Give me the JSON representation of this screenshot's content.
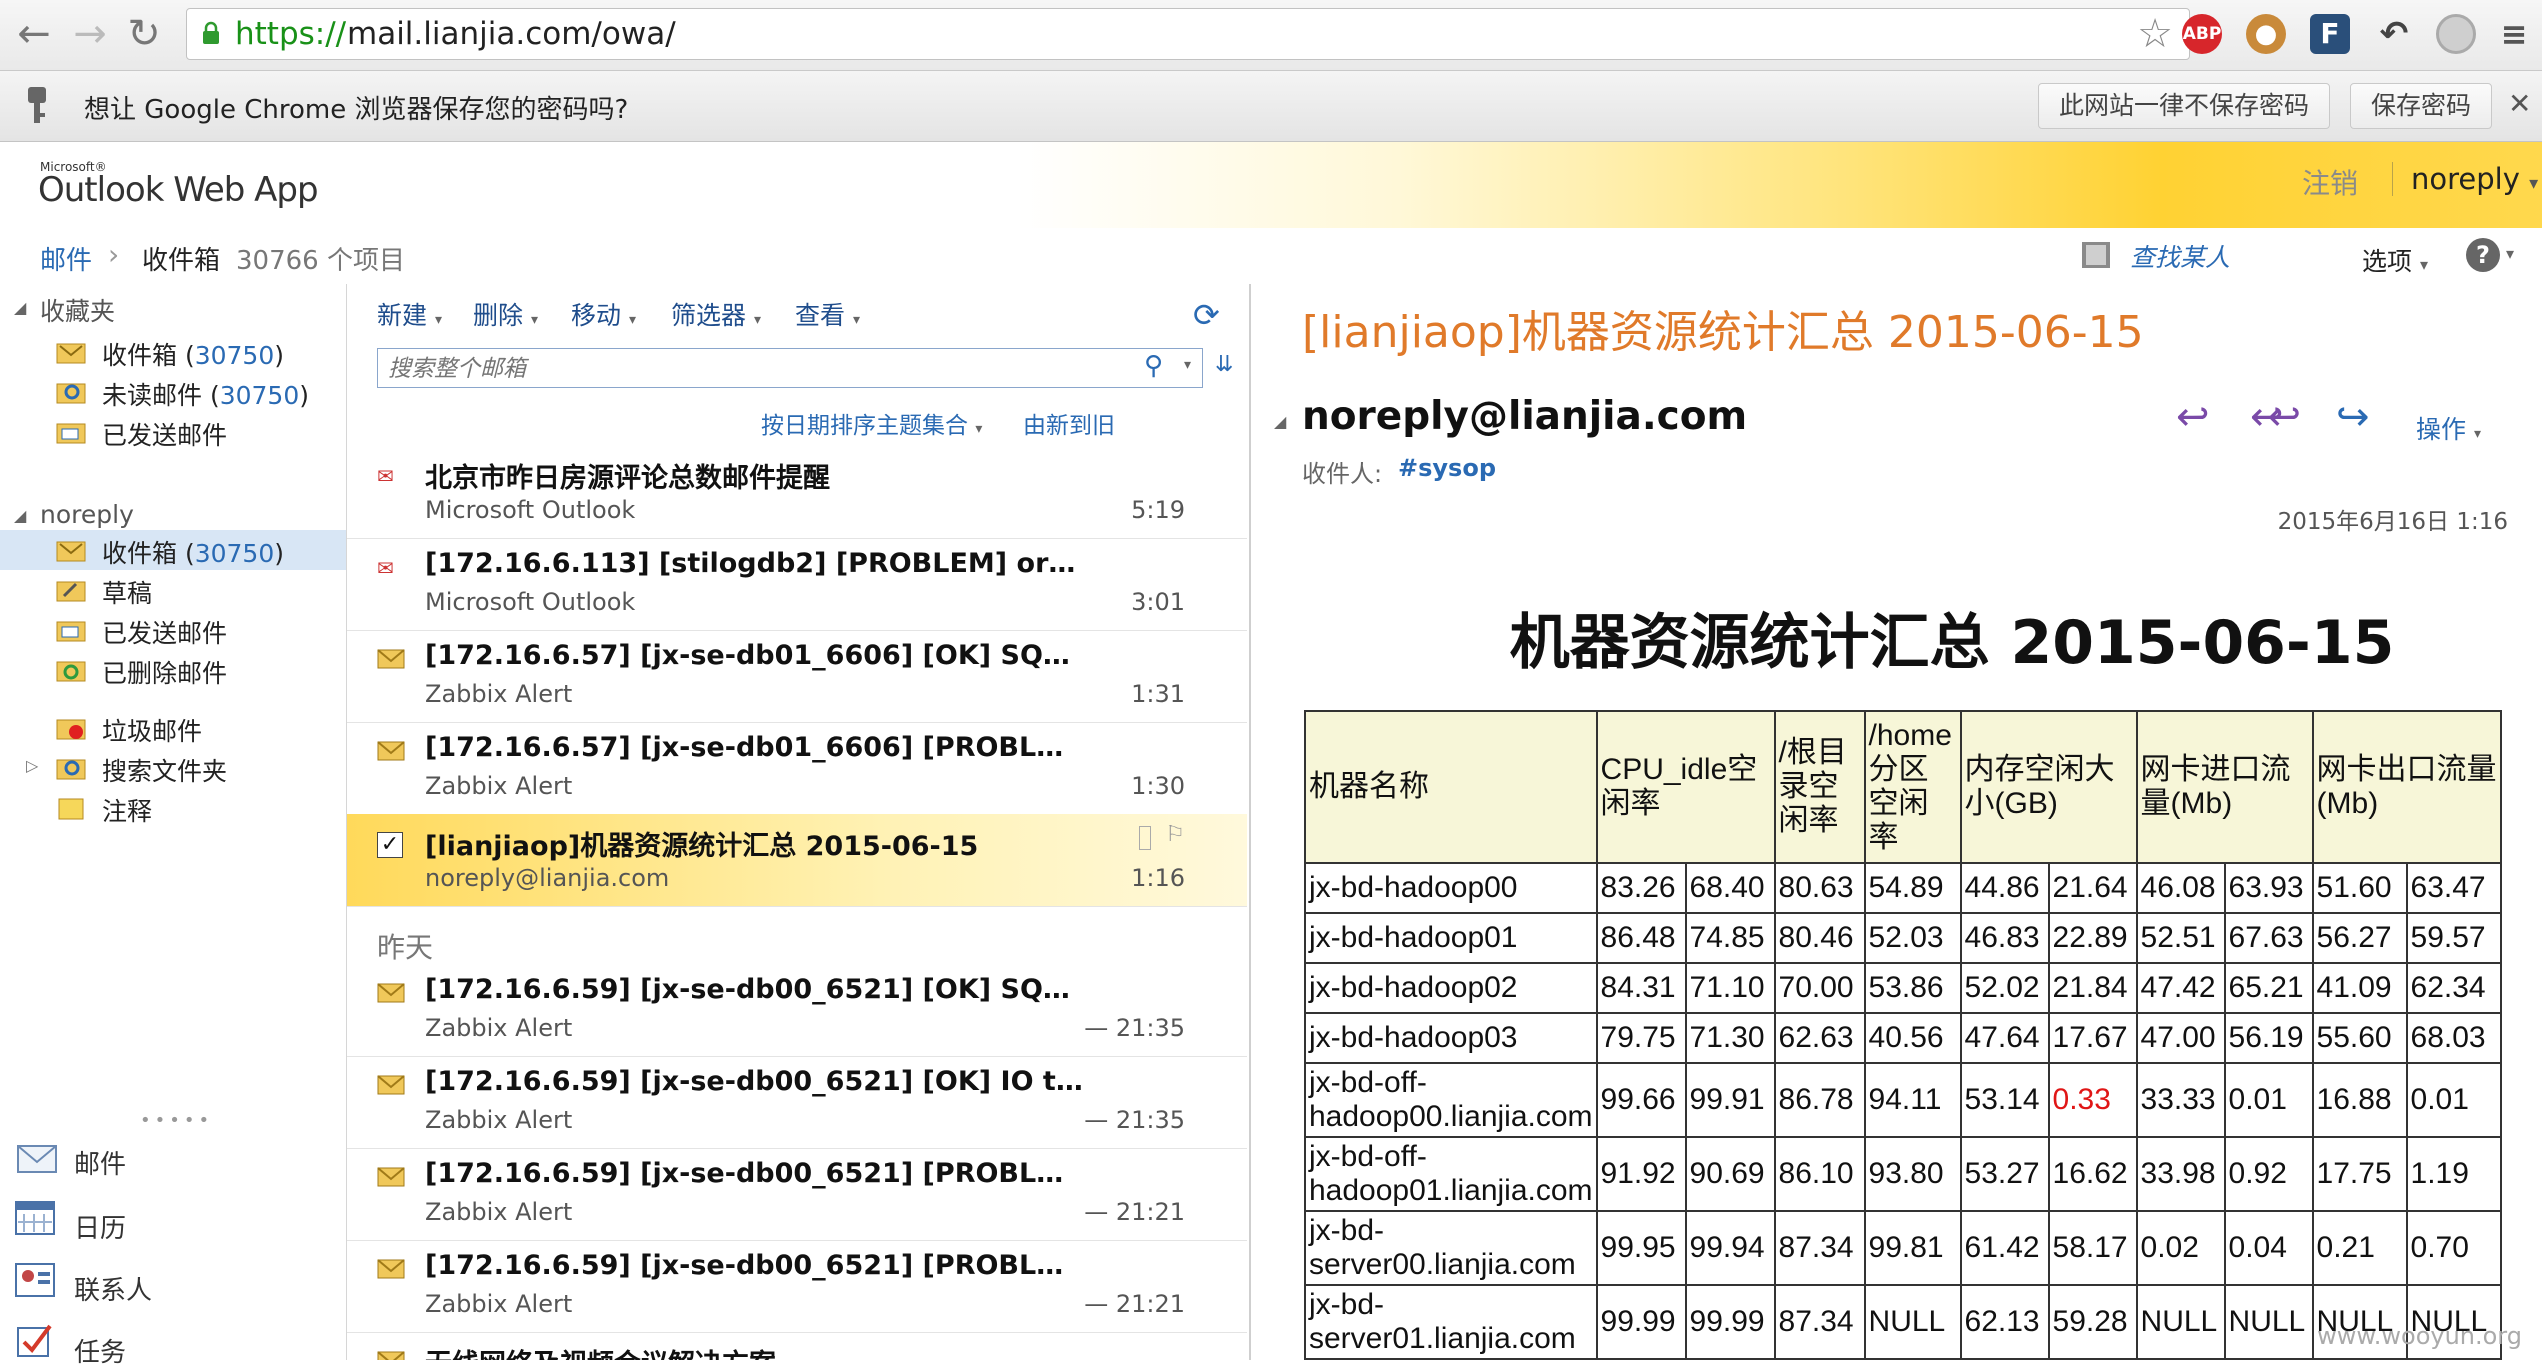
{
  "browser": {
    "url_scheme": "https://",
    "url_rest": "mail.lianjia.com/owa/",
    "ext_abp": "ABP",
    "ext_f": "F"
  },
  "password_bar": {
    "message": "想让 Google Chrome 浏览器保存您的密码吗?",
    "never_label": "此网站一律不保存密码",
    "save_label": "保存密码",
    "close_glyph": "✕"
  },
  "owa": {
    "logo_small": "Microsoft®",
    "logo": "Outlook Web App",
    "logout": "注销",
    "user": "noreply"
  },
  "breadcrumb": {
    "root": "邮件",
    "sep": "›",
    "folder": "收件箱",
    "count": "30766 个项目",
    "find_people": "查找某人",
    "options": "选项",
    "help": "?"
  },
  "nav": {
    "favorites_header": "收藏夹",
    "favorites": [
      {
        "label": "收件箱",
        "count": "30750"
      },
      {
        "label": "未读邮件",
        "count": "30750"
      },
      {
        "label": "已发送邮件",
        "count": ""
      }
    ],
    "account_header": "noreply",
    "folders": [
      {
        "label": "收件箱",
        "count": "30750"
      },
      {
        "label": "草稿",
        "count": ""
      },
      {
        "label": "已发送邮件",
        "count": ""
      },
      {
        "label": "已删除邮件",
        "count": ""
      },
      {
        "label": "垃圾邮件",
        "count": ""
      },
      {
        "label": "搜索文件夹",
        "count": ""
      },
      {
        "label": "注释",
        "count": ""
      }
    ],
    "modules": [
      "邮件",
      "日历",
      "联系人",
      "任务"
    ]
  },
  "toolbar": {
    "new": "新建",
    "delete": "删除",
    "move": "移动",
    "filter": "筛选器",
    "view": "查看",
    "search_placeholder": "搜索整个邮箱",
    "sort": "按日期排序主题集合",
    "order": "由新到旧"
  },
  "messages_today": [
    {
      "subject": "北京市昨日房源评论总数邮件提醒",
      "from": "Microsoft Outlook",
      "time": "5:19",
      "icon": "meeting-icon"
    },
    {
      "subject": "[172.16.6.113] [stilogdb2] [PROBLEM] or…",
      "from": "Microsoft Outlook",
      "time": "3:01",
      "icon": "meeting-icon"
    },
    {
      "subject": "[172.16.6.57] [jx-se-db01_6606] [OK] SQ…",
      "from": "Zabbix Alert",
      "time": "1:31",
      "icon": "envelope-icon"
    },
    {
      "subject": "[172.16.6.57] [jx-se-db01_6606] [PROBL…",
      "from": "Zabbix Alert",
      "time": "1:30",
      "icon": "envelope-icon"
    },
    {
      "subject": "[lianjiaop]机器资源统计汇总 2015-06-15",
      "from": "noreply@lianjia.com",
      "time": "1:16",
      "icon": "checkbox-icon"
    }
  ],
  "yesterday_label": "昨天",
  "messages_yesterday": [
    {
      "subject": "[172.16.6.59] [jx-se-db00_6521] [OK] SQ…",
      "from": "Zabbix Alert",
      "time": "— 21:35"
    },
    {
      "subject": "[172.16.6.59] [jx-se-db00_6521] [OK] IO t…",
      "from": "Zabbix Alert",
      "time": "— 21:35"
    },
    {
      "subject": "[172.16.6.59] [jx-se-db00_6521] [PROBL…",
      "from": "Zabbix Alert",
      "time": "— 21:21"
    },
    {
      "subject": "[172.16.6.59] [jx-se-db00_6521] [PROBL…",
      "from": "Zabbix Alert",
      "time": "— 21:21"
    },
    {
      "subject": "无线网络及视频会议解决方案",
      "from": "",
      "time": ""
    }
  ],
  "reader": {
    "title": "[lianjiaop]机器资源统计汇总 2015-06-15",
    "sender": "noreply@lianjia.com",
    "to_label": "收件人:",
    "to": "#sysop",
    "actions": "操作",
    "date": "2015年6月16日 1:16",
    "heading": "机器资源统计汇总 2015-06-15",
    "table_headers": [
      "机器名称",
      "CPU_idle空闲率",
      "/根目录空闲率",
      "/home分区空闲率",
      "内存空闲大小(GB)",
      "网卡进口流量(Mb)",
      "网卡出口流量(Mb)"
    ],
    "rows": [
      [
        "jx-bd-hadoop00",
        "83.26",
        "68.40",
        "80.63",
        "54.89",
        "44.86",
        "21.64",
        "46.08",
        "63.93",
        "51.60",
        "63.47"
      ],
      [
        "jx-bd-hadoop01",
        "86.48",
        "74.85",
        "80.46",
        "52.03",
        "46.83",
        "22.89",
        "52.51",
        "67.63",
        "56.27",
        "59.57"
      ],
      [
        "jx-bd-hadoop02",
        "84.31",
        "71.10",
        "70.00",
        "53.86",
        "52.02",
        "21.84",
        "47.42",
        "65.21",
        "41.09",
        "62.34"
      ],
      [
        "jx-bd-hadoop03",
        "79.75",
        "71.30",
        "62.63",
        "40.56",
        "47.64",
        "17.67",
        "47.00",
        "56.19",
        "55.60",
        "68.03"
      ],
      [
        "jx-bd-off-hadoop00.lianjia.com",
        "99.66",
        "99.91",
        "86.78",
        "94.11",
        "53.14",
        "0.33",
        "33.33",
        "0.01",
        "16.88",
        "0.01"
      ],
      [
        "jx-bd-off-hadoop01.lianjia.com",
        "91.92",
        "90.69",
        "86.10",
        "93.80",
        "53.27",
        "16.62",
        "33.98",
        "0.92",
        "17.75",
        "1.19"
      ],
      [
        "jx-bd-server00.lianjia.com",
        "99.95",
        "99.94",
        "87.34",
        "99.81",
        "61.42",
        "58.17",
        "0.02",
        "0.04",
        "0.21",
        "0.70"
      ],
      [
        "jx-bd-server01.lianjia.com",
        "99.99",
        "99.99",
        "87.34",
        "NULL",
        "62.13",
        "59.28",
        "NULL",
        "NULL",
        "NULL",
        "NULL"
      ]
    ],
    "red_cell": {
      "row": 4,
      "col": 6
    }
  },
  "watermark": "www.wooyun.org",
  "colors": {
    "accent_blue": "#2a6ab3",
    "title_orange": "#e07a2a",
    "url_green": "#199118",
    "alert_red": "#e01616"
  }
}
